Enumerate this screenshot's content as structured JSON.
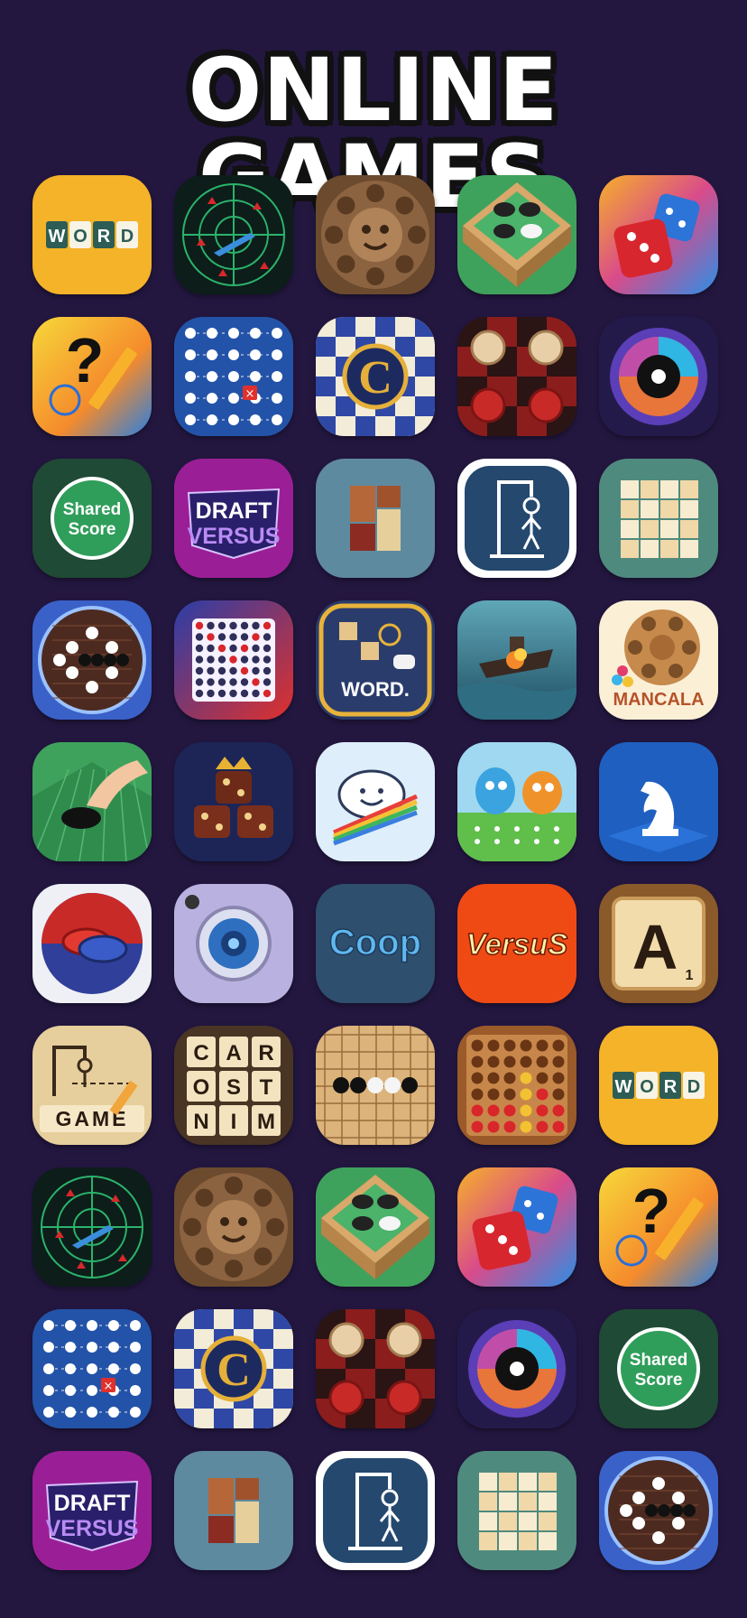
{
  "header": {
    "title": "ONLINE GAMES"
  },
  "icons": {
    "word_text": "WORD",
    "shared_score": "Shared\nScore",
    "draft": "DRAFT",
    "versus": "VERSUS",
    "coop": "Coop",
    "versus_logo": "VersuS",
    "scrabble_letter": "A",
    "scrabble_value": "1",
    "word_dot": "WORD.",
    "mancala": "MANCALA",
    "game": "GAME",
    "car": "CAR",
    "ost": "OST",
    "nim": "NIM"
  },
  "colors": {
    "background": "#231740",
    "title": "#ffffff"
  }
}
